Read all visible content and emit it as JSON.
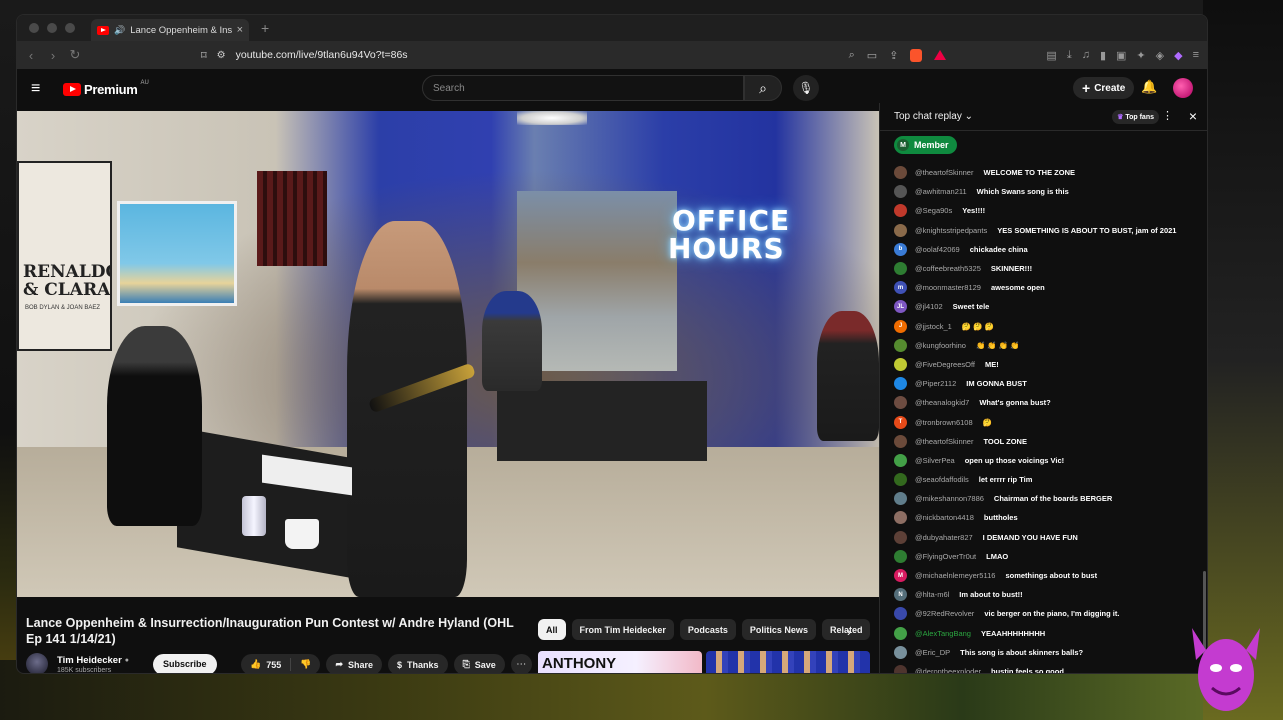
{
  "browser": {
    "tab_title": "Lance Oppenheim & Insurre",
    "url": "youtube.com/live/9tlan6u94Vo?t=86s",
    "extension_badge": "10"
  },
  "youtube": {
    "brand": "Premium",
    "region": "AU",
    "search_placeholder": "Search",
    "create_label": "Create"
  },
  "video": {
    "neon_sign": "OFFICE\nHOURS",
    "poster_text": "RENALDO\n& CLARA",
    "poster_sub": "BOB DYLAN & JOAN BAEZ"
  },
  "info": {
    "title": "Lance Oppenheim & Insurrection/Inauguration Pun Contest w/ Andre Hyland (OHL Ep 141 1/14/21)",
    "channel": "Tim Heidecker",
    "subscribers": "185K subscribers",
    "subscribe_label": "Subscribe",
    "likes": "755",
    "share_label": "Share",
    "thanks_label": "Thanks",
    "save_label": "Save",
    "chips": [
      "All",
      "From Tim Heidecker",
      "Podcasts",
      "Politics News",
      "Related"
    ],
    "thumb1_text": "ANTHONY"
  },
  "chat": {
    "header": "Top chat replay",
    "top_fans": "Top fans",
    "member_label": "Member",
    "member_initial": "M",
    "messages": [
      {
        "user": "@theartofSkinner",
        "text": "WELCOME TO THE ZONE",
        "color": "#6b4a3a",
        "initial": ""
      },
      {
        "user": "@awhitman211",
        "text": "Which Swans song is this",
        "color": "#555555",
        "initial": ""
      },
      {
        "user": "@Sega90s",
        "text": "Yes!!!!",
        "color": "#c0392b",
        "initial": ""
      },
      {
        "user": "@knightsstripedpants",
        "text": "YES SOMETHING IS ABOUT TO BUST, jam of 2021",
        "color": "#8a6a4a",
        "initial": ""
      },
      {
        "user": "@oolaf42069",
        "text": "chickadee china",
        "color": "#3a7bd5",
        "initial": "b"
      },
      {
        "user": "@coffeebreath5325",
        "text": "SKINNER!!!",
        "color": "#2e7d32",
        "initial": ""
      },
      {
        "user": "@moonmaster8129",
        "text": "awesome open",
        "color": "#3f51b5",
        "initial": "m"
      },
      {
        "user": "@jl4102",
        "text": "Sweet tele",
        "color": "#7e57c2",
        "initial": "JL"
      },
      {
        "user": "@jjstock_1",
        "text": "🤔 🤔 🤔",
        "color": "#ef6c00",
        "initial": "J"
      },
      {
        "user": "@kungfoorhino",
        "text": "👏 👏 👏 👏",
        "color": "#558b2f",
        "initial": ""
      },
      {
        "user": "@FiveDegreesOff",
        "text": "ME!",
        "color": "#c0ca33",
        "initial": ""
      },
      {
        "user": "@Piper2112",
        "text": "IM GONNA BUST",
        "color": "#1e88e5",
        "initial": ""
      },
      {
        "user": "@theanalogkid7",
        "text": "What's gonna bust?",
        "color": "#6d4c41",
        "initial": ""
      },
      {
        "user": "@tronbrown6108",
        "text": "🤔",
        "color": "#e64a19",
        "initial": "T"
      },
      {
        "user": "@theartofSkinner",
        "text": "TOOL ZONE",
        "color": "#6b4a3a",
        "initial": ""
      },
      {
        "user": "@SilverPea",
        "text": "open up those voicings Vic!",
        "color": "#43a047",
        "initial": ""
      },
      {
        "user": "@seaofdaffodils",
        "text": "let errrr rip Tim",
        "color": "#33691e",
        "initial": ""
      },
      {
        "user": "@mikeshannon7886",
        "text": "Chairman of the boards BERGER",
        "color": "#607d8b",
        "initial": ""
      },
      {
        "user": "@nickbarton4418",
        "text": "buttholes",
        "color": "#8d6e63",
        "initial": ""
      },
      {
        "user": "@dubyahater827",
        "text": "I DEMAND YOU HAVE FUN",
        "color": "#5d4037",
        "initial": ""
      },
      {
        "user": "@FlyingOverTr0ut",
        "text": "LMAO",
        "color": "#2e7d32",
        "initial": ""
      },
      {
        "user": "@michaelnlemeyer5116",
        "text": "somethings about to bust",
        "color": "#d81b60",
        "initial": "M"
      },
      {
        "user": "@hlta-m6l",
        "text": "Im about to bust!!",
        "color": "#546e7a",
        "initial": "N"
      },
      {
        "user": "@92RedRevolver",
        "text": "vic berger on the piano, I'm digging it.",
        "color": "#3949ab",
        "initial": ""
      },
      {
        "user": "@AlexTangBang",
        "text": "YEAAHHHHHHHH",
        "color": "#43a047",
        "initial": "",
        "member": true
      },
      {
        "user": "@Eric_DP",
        "text": "This song is about skinners balls?",
        "color": "#78909c",
        "initial": ""
      },
      {
        "user": "@derontheexploder",
        "text": "bustin feels so good",
        "color": "#4e342e",
        "initial": ""
      }
    ]
  },
  "colors": {
    "youtube_red": "#ff0000",
    "member_green": "#0f8a3f",
    "background": "#0f0f0f"
  },
  "icons": [
    "hamburger-icon",
    "search-icon",
    "mic-icon",
    "plus-icon",
    "bell-icon",
    "verified-icon",
    "like-icon",
    "dislike-icon",
    "share-icon",
    "thanks-icon",
    "save-icon",
    "more-icon",
    "chevron-right-icon",
    "close-icon",
    "chevron-down-icon"
  ]
}
